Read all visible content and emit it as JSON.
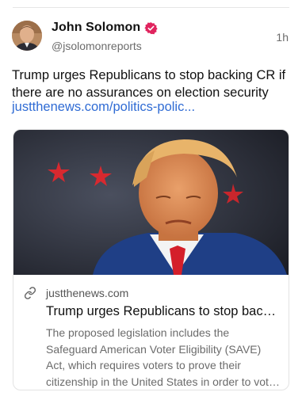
{
  "post": {
    "author": {
      "display_name": "John Solomon",
      "handle": "@jsolomonreports",
      "verified": true
    },
    "timestamp": "1h",
    "text": "Trump urges Republicans to stop backing CR if there are no assurances on election security",
    "link_text": "justthenews.com/politics-polic...",
    "link_card": {
      "domain": "justthenews.com",
      "title": "Trump urges Republicans to stop backing CR if there are no assurances on election security",
      "description": "The proposed legislation includes the Safeguard American Voter Eligibility (SAVE) Act, which requires voters to prove their citizenship in the United States in order to vote in federal elections."
    }
  },
  "colors": {
    "link": "#2f6bd4",
    "verified_badge": "#e0245e",
    "muted_text": "#6b6b6b"
  },
  "icons": {
    "verified": "verified-badge-icon",
    "link": "link-icon"
  }
}
